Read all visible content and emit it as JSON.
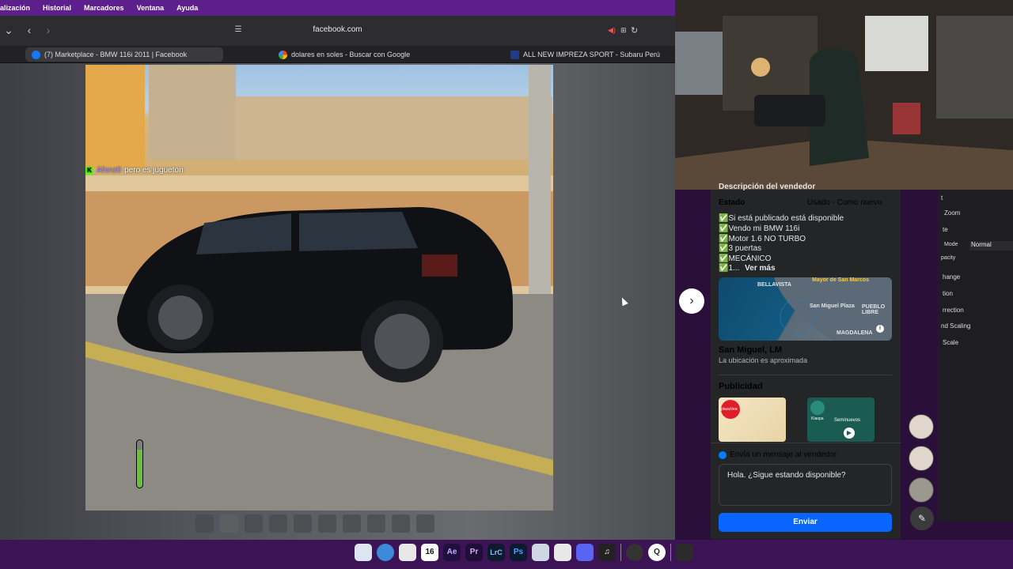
{
  "menubar": {
    "items": [
      "alización",
      "Historial",
      "Marcadores",
      "Ventana",
      "Ayuda"
    ]
  },
  "browser": {
    "url": "facebook.com",
    "tabs": [
      {
        "label": "(7) Marketplace - BMW 116i 2011 | Facebook",
        "icon": "facebook-icon",
        "active": true
      },
      {
        "label": "dolares en soles - Buscar con Google",
        "icon": "google-icon",
        "active": false
      },
      {
        "label": "ALL NEW IMPREZA SPORT - Subaru Perú",
        "icon": "subaru-icon",
        "active": false
      }
    ]
  },
  "stream_chat": {
    "username": "Afonz0",
    "message": "pero es jugueton"
  },
  "listing": {
    "section_title": "Descripción del vendedor",
    "condition_label": "Estado",
    "condition_value": "Usado - Como nuevo",
    "description_lines": [
      "✅Si está publicado está disponible",
      "✅Vendo mi BMW 116i",
      "✅Motor 1.6 NO TURBO",
      "✅3 puertas",
      "✅MECÁNICO",
      "✅1..."
    ],
    "see_more": "Ver más",
    "map_labels": [
      "BELLAVISTA",
      "Mayor de San Marcos",
      "San Miguel Plaza",
      "PUEBLO LIBRE",
      "MAGDALENA"
    ],
    "location": "San Miguel, LM",
    "location_note": "La ubicación es aproximada",
    "ads_title": "Publicidad",
    "ads": [
      {
        "brand": "plazaVea"
      },
      {
        "brand": "Kiaopa",
        "caption": "Seminuevos"
      }
    ],
    "message_title": "Envía un mensaje al vendedor",
    "message_text": "Hola. ¿Sigue estando disponible?",
    "send_label": "Enviar"
  },
  "editor_panel": {
    "rows": [
      "t",
      "Zoom",
      "te",
      "Mode",
      "pacity",
      "hange",
      "tion",
      "rrection",
      "nd Scaling",
      "Scale"
    ],
    "mode_value": "Normal"
  },
  "dock": {
    "items": [
      "Finder",
      "Safari",
      "Notes",
      "16",
      "Ae",
      "Pr",
      "LrC",
      "Ps",
      "Preview",
      "Kit",
      "Discord",
      "Music",
      "Activity",
      "Q",
      "Trash"
    ]
  }
}
